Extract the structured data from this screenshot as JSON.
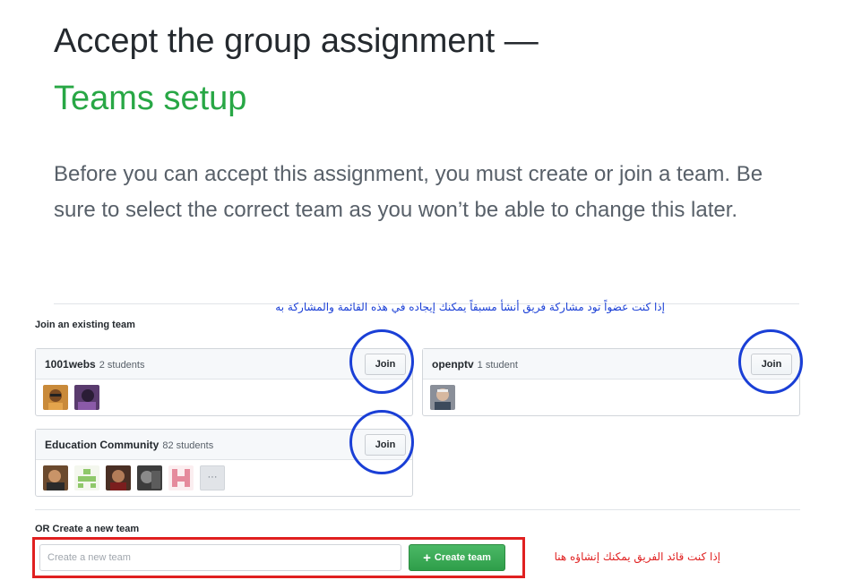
{
  "header": {
    "title": "Accept the group assignment —",
    "subtitle": "Teams setup"
  },
  "intro": "Before you can accept this assignment, you must create or join a team. Be sure to select the correct team as you won’t be able to change this later.",
  "annotations": {
    "join_note": "إذا كنت عضواً تود مشاركة فريق أنشأ مسبقاً يمكنك إيجاده في هذه القائمة والمشاركة به",
    "create_note": "إذا كنت قائد الفريق يمكنك إنشاؤه هنا",
    "circle_color": "#1a3fd6",
    "box_color": "#e02020"
  },
  "join_section": {
    "label": "Join an existing team",
    "teams": [
      {
        "name": "1001webs",
        "count": "2 students",
        "join_label": "Join",
        "avatars": [
          "avatar-1",
          "avatar-2"
        ]
      },
      {
        "name": "openptv",
        "count": "1 student",
        "join_label": "Join",
        "avatars": [
          "avatar-3"
        ]
      },
      {
        "name": "Education Community",
        "count": "82 students",
        "join_label": "Join",
        "avatars": [
          "avatar-4",
          "avatar-5",
          "avatar-6",
          "avatar-7",
          "avatar-8"
        ],
        "more_label": "···"
      }
    ]
  },
  "create_section": {
    "label": "OR Create a new team",
    "input_placeholder": "Create a new team",
    "input_value": "",
    "button_icon": "plus-icon",
    "button_label": "Create team"
  },
  "colors": {
    "title": "#24292e",
    "subtitle": "#28a745",
    "create_button": "#2f9e4a"
  }
}
